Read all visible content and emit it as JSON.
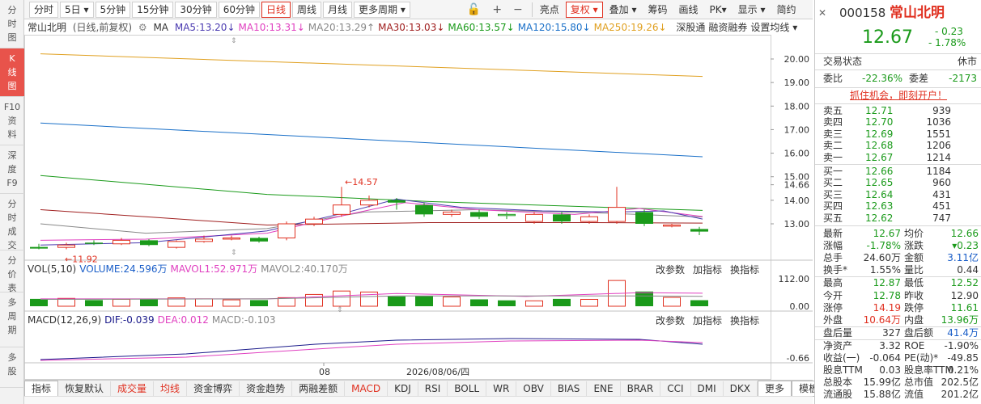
{
  "left_rail": [
    {
      "label": [
        "分",
        "时",
        "图"
      ],
      "active": false
    },
    {
      "label": [
        "K",
        "线",
        "图"
      ],
      "active": true
    },
    {
      "label": [
        "F10",
        "资",
        "料"
      ],
      "active": false
    },
    {
      "label": [
        "深",
        "度",
        "F9"
      ],
      "active": false
    },
    {
      "label": [
        "分",
        "时",
        "成",
        "交"
      ],
      "active": false
    },
    {
      "label": [
        "分",
        "价",
        "表"
      ],
      "active": false
    },
    {
      "label": [
        "多",
        "周",
        "期"
      ],
      "active": false
    },
    {
      "label": [
        "多",
        "股"
      ],
      "active": false
    }
  ],
  "toolbar": {
    "periods": [
      "分时",
      "5日 ▾",
      "5分钟",
      "15分钟",
      "30分钟",
      "60分钟",
      "日线",
      "周线",
      "月线",
      "更多周期 ▾"
    ],
    "active_period": "日线",
    "tools": [
      "亮点",
      "复权 ▾",
      "叠加 ▾",
      "筹码",
      "画线",
      "PK▾",
      "显示 ▾",
      "简约"
    ],
    "icons": [
      "lock-icon",
      "plus-icon",
      "minus-icon"
    ]
  },
  "ma_bar": {
    "stock": "常山北明",
    "mode": "(日线,前复权)",
    "ma_label": "MA",
    "items": [
      {
        "text": "MA5:13.20↓",
        "color": "#4a3ab0"
      },
      {
        "text": "MA10:13.31↓",
        "color": "#e040c0"
      },
      {
        "text": "MA20:13.29↑",
        "color": "#888888"
      },
      {
        "text": "MA30:13.03↓",
        "color": "#a02020"
      },
      {
        "text": "MA60:13.57↓",
        "color": "#1a9a1a"
      },
      {
        "text": "MA120:15.80↓",
        "color": "#1a70c8"
      },
      {
        "text": "MA250:19.26↓",
        "color": "#e0a020"
      }
    ],
    "links": [
      "深股通",
      "融资融券",
      "设置均线 ▾"
    ]
  },
  "price_axis": [
    "20.00",
    "19.00",
    "18.00",
    "17.00",
    "16.00",
    "15.00",
    "14.66",
    "14.00",
    "13.00"
  ],
  "annotations": {
    "high": "←14.57",
    "low": "←11.92"
  },
  "volume": {
    "label": "VOL(5,10)",
    "items": [
      {
        "text": "VOLUME:24.596万",
        "color": "#1a5ec8"
      },
      {
        "text": "MAVOL1:52.971万",
        "color": "#e040c0"
      },
      {
        "text": "MAVOL2:40.170万",
        "color": "#888888"
      }
    ],
    "axis": [
      "112.00",
      "0.00"
    ]
  },
  "macd": {
    "label": "MACD(12,26,9)",
    "items": [
      {
        "text": "DIF:-0.039",
        "color": "#1a1a8a"
      },
      {
        "text": "DEA:0.012",
        "color": "#e040c0"
      },
      {
        "text": "MACD:-0.103",
        "color": "#888888"
      }
    ],
    "axis": [
      "-0.66"
    ]
  },
  "panel_buttons": [
    "改参数",
    "加指标",
    "换指标"
  ],
  "x_axis": {
    "month": "08",
    "date": "2026/08/06/四"
  },
  "bottom_tabs": [
    "指标",
    "恢复默认",
    "成交量",
    "均线",
    "资金博弈",
    "资金趋势",
    "两融差额",
    "MACD",
    "KDJ",
    "RSI",
    "BOLL",
    "WR",
    "OBV",
    "BIAS",
    "ENE",
    "BRAR",
    "CCI",
    "DMI",
    "DKX",
    "更多",
    "模板"
  ],
  "bottom_tabs_red": [
    "成交量",
    "均线",
    "MACD"
  ],
  "quote": {
    "code": "000158",
    "name": "常山北明",
    "price": "12.67",
    "change": "- 0.23",
    "change_pct": "- 1.78%",
    "status_label": "交易状态",
    "status": "休市",
    "webi_label": "委比",
    "webi": "-22.36%",
    "weicha_label": "委差",
    "weicha": "-2173",
    "ad": "抓住机会，即刻开户！",
    "asks": [
      {
        "label": "卖五",
        "price": "12.71",
        "vol": "939"
      },
      {
        "label": "卖四",
        "price": "12.70",
        "vol": "1036"
      },
      {
        "label": "卖三",
        "price": "12.69",
        "vol": "1551"
      },
      {
        "label": "卖二",
        "price": "12.68",
        "vol": "1206"
      },
      {
        "label": "卖一",
        "price": "12.67",
        "vol": "1214"
      }
    ],
    "bids": [
      {
        "label": "买一",
        "price": "12.66",
        "vol": "1184"
      },
      {
        "label": "买二",
        "price": "12.65",
        "vol": "960"
      },
      {
        "label": "买三",
        "price": "12.64",
        "vol": "431"
      },
      {
        "label": "买四",
        "price": "12.63",
        "vol": "451"
      },
      {
        "label": "买五",
        "price": "12.62",
        "vol": "747"
      }
    ],
    "stats": [
      [
        {
          "l": "最新",
          "v": "12.67",
          "c": "green"
        },
        {
          "l": "均价",
          "v": "12.66",
          "c": "green"
        }
      ],
      [
        {
          "l": "涨幅",
          "v": "-1.78%",
          "c": "green"
        },
        {
          "l": "涨跌",
          "v": "▾0.23",
          "c": "green"
        }
      ],
      [
        {
          "l": "总手",
          "v": "24.60万",
          "c": ""
        },
        {
          "l": "金额",
          "v": "3.11亿",
          "c": "blue"
        }
      ],
      [
        {
          "l": "换手*",
          "v": "1.55%",
          "c": ""
        },
        {
          "l": "量比",
          "v": "0.44",
          "c": ""
        }
      ],
      [
        {
          "l": "最高",
          "v": "12.87",
          "c": "green"
        },
        {
          "l": "最低",
          "v": "12.52",
          "c": "green"
        }
      ],
      [
        {
          "l": "今开",
          "v": "12.78",
          "c": "green"
        },
        {
          "l": "昨收",
          "v": "12.90",
          "c": ""
        }
      ],
      [
        {
          "l": "涨停",
          "v": "14.19",
          "c": "red"
        },
        {
          "l": "跌停",
          "v": "11.61",
          "c": "green"
        }
      ],
      [
        {
          "l": "外盘",
          "v": "10.64万",
          "c": "red"
        },
        {
          "l": "内盘",
          "v": "13.96万",
          "c": "green"
        }
      ],
      [
        {
          "l": "盘后量",
          "v": "327",
          "c": ""
        },
        {
          "l": "盘后额",
          "v": "41.4万",
          "c": "blue"
        }
      ],
      [
        {
          "l": "净资产",
          "v": "3.32",
          "c": ""
        },
        {
          "l": "ROE",
          "v": "-1.90%",
          "c": ""
        }
      ],
      [
        {
          "l": "收益(一)",
          "v": "-0.064",
          "c": ""
        },
        {
          "l": "PE(动)*",
          "v": "-49.85",
          "c": ""
        }
      ],
      [
        {
          "l": "股息TTM",
          "v": "0.03",
          "c": ""
        },
        {
          "l": "股息率TTM",
          "v": "0.21%",
          "c": ""
        }
      ],
      [
        {
          "l": "总股本",
          "v": "15.99亿",
          "c": ""
        },
        {
          "l": "总市值",
          "v": "202.5亿",
          "c": ""
        }
      ],
      [
        {
          "l": "流通股",
          "v": "15.88亿",
          "c": ""
        },
        {
          "l": "流值",
          "v": "201.2亿",
          "c": ""
        }
      ]
    ]
  },
  "colors": {
    "up": "#e03020",
    "down": "#1a9a1a",
    "accent": "#e03020"
  }
}
